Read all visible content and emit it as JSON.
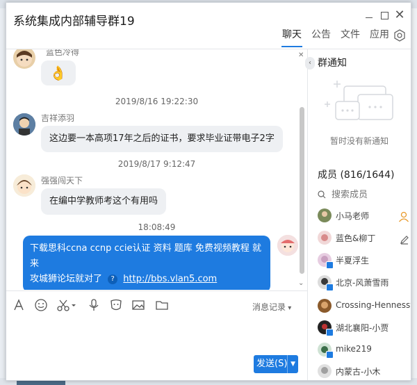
{
  "window": {
    "title": "系统集成内部辅导群19"
  },
  "tabs": [
    {
      "label": "聊天",
      "active": true
    },
    {
      "label": "公告"
    },
    {
      "label": "文件"
    },
    {
      "label": "应用"
    }
  ],
  "chat": {
    "top_partial_name": "蓝色冷得",
    "top_emoji": "👌",
    "timestamps": [
      "2019/8/16 19:22:30",
      "2019/8/17 9:12:47",
      "18:08:49"
    ],
    "messages": [
      {
        "sender": "吉祥添羽",
        "text": "这边要一本高项17年之后的证书，要求毕业证带电子2字"
      },
      {
        "sender": "强强闯天下",
        "text": "在编中学教师考这个有用吗"
      }
    ],
    "self_message": {
      "line1": "下载思科ccna ccnp ccie认证 资料 题库 免费视频教程 就来",
      "line2_prefix": "攻城狮论坛就对了",
      "link": "http://bbs.vlan5.com",
      "qmark": "?"
    }
  },
  "toolbar": {
    "history_label": "消息记录",
    "send_label": "发送(S)"
  },
  "notice": {
    "title": "群通知",
    "empty": "暂时没有新通知"
  },
  "members": {
    "title": "成员 (816/1644)",
    "search_placeholder": "搜索成员",
    "list": [
      {
        "name": "小马老师",
        "color": "#7a8a5a"
      },
      {
        "name": "蓝色&柳丁",
        "color": "#d88b8b"
      },
      {
        "name": "半夏浮生",
        "color": "#c9a0c0"
      },
      {
        "name": "北京-风萧雪雨",
        "color": "#3a3a3a"
      },
      {
        "name": "Crossing-Hennessy",
        "color": "#8b5a2b"
      },
      {
        "name": "湖北襄阳-小贾",
        "color": "#222222"
      },
      {
        "name": "mike219",
        "color": "#3b6e4a"
      },
      {
        "name": "内蒙古-小木",
        "color": "#a0a0a0"
      }
    ]
  },
  "colors": {
    "accent": "#1e7be0",
    "bubble_other": "#eef0f3"
  }
}
